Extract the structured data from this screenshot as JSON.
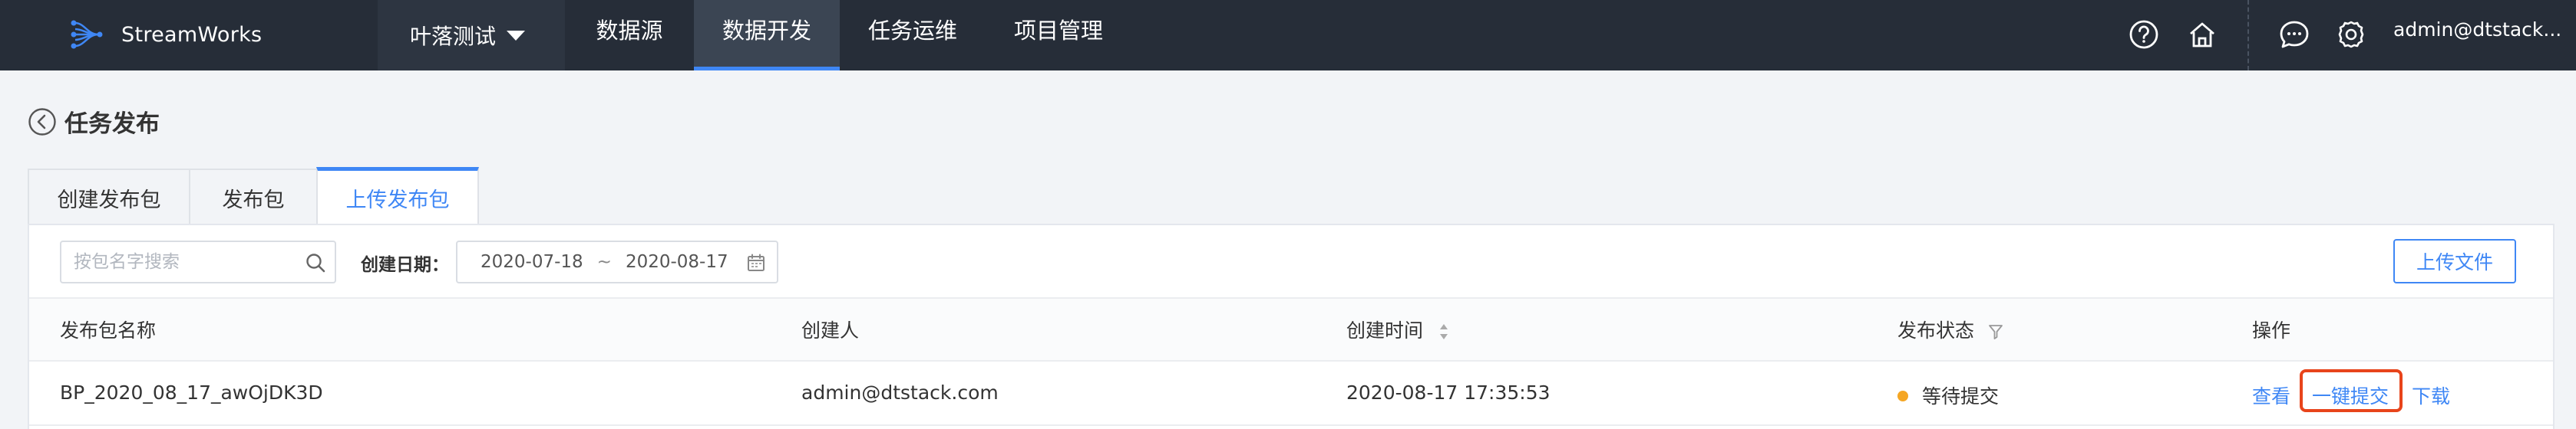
{
  "topnav": {
    "logo_text": "StreamWorks",
    "project": "叶落测试",
    "items": [
      "数据源",
      "数据开发",
      "任务运维",
      "项目管理"
    ],
    "active_item": "数据开发",
    "user": "admin@dtstack..."
  },
  "page": {
    "title": "任务发布"
  },
  "tabs": [
    {
      "label": "创建发布包"
    },
    {
      "label": "发布包"
    },
    {
      "label": "上传发布包"
    }
  ],
  "active_tab": "上传发布包",
  "filters": {
    "search_placeholder": "按包名字搜索",
    "date_label": "创建日期：",
    "date_start": "2020-07-18",
    "date_sep": "~",
    "date_end": "2020-08-17",
    "upload_label": "上传文件"
  },
  "table": {
    "columns": [
      "发布包名称",
      "创建人",
      "创建时间",
      "发布状态",
      "操作"
    ],
    "rows": [
      {
        "name": "BP_2020_08_17_awOjDK3D",
        "creator": "admin@dtstack.com",
        "created_at": "2020-08-17 17:35:53",
        "status": "等待提交",
        "status_color": "#f5a623",
        "actions": [
          "查看",
          "一键提交",
          "下载"
        ]
      }
    ]
  },
  "colors": {
    "nav_bg": "#262d38",
    "accent": "#3f87f5",
    "highlight": "#e8441b"
  }
}
